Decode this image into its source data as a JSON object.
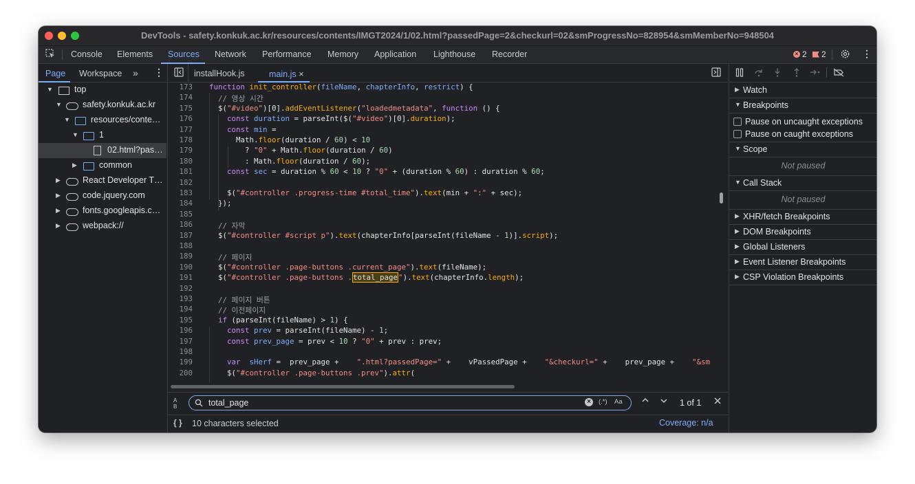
{
  "window": {
    "title": "DevTools - safety.konkuk.ac.kr/resources/contents/IMGT2024/1/02.html?passedPage=2&checkurl=02&smProgressNo=828954&smMemberNo=948504"
  },
  "main_tabs": [
    "Console",
    "Elements",
    "Sources",
    "Network",
    "Performance",
    "Memory",
    "Application",
    "Lighthouse",
    "Recorder"
  ],
  "active_main_tab": "Sources",
  "counts": {
    "errors": "2",
    "warnings": "2"
  },
  "navigator": {
    "tabs": [
      "Page",
      "Workspace"
    ],
    "more": "»",
    "tree": [
      {
        "label": "top",
        "type": "frame",
        "depth": 0,
        "arrow": "▼"
      },
      {
        "label": "safety.konkuk.ac.kr",
        "type": "cloud",
        "depth": 1,
        "arrow": "▼"
      },
      {
        "label": "resources/conte…",
        "type": "folder",
        "depth": 2,
        "arrow": "▼"
      },
      {
        "label": "1",
        "type": "folder",
        "depth": 3,
        "arrow": "▼"
      },
      {
        "label": "02.html?pas…",
        "type": "file",
        "depth": 4,
        "arrow": "",
        "selected": true
      },
      {
        "label": "common",
        "type": "folder",
        "depth": 3,
        "arrow": "▶"
      },
      {
        "label": "React Developer T…",
        "type": "cloud",
        "depth": 1,
        "arrow": "▶"
      },
      {
        "label": "code.jquery.com",
        "type": "cloud",
        "depth": 1,
        "arrow": "▶"
      },
      {
        "label": "fonts.googleapis.c…",
        "type": "cloud",
        "depth": 1,
        "arrow": "▶"
      },
      {
        "label": "webpack://",
        "type": "cloud",
        "depth": 1,
        "arrow": "▶"
      }
    ]
  },
  "editor": {
    "tabs": [
      {
        "label": "installHook.js",
        "active": false
      },
      {
        "label": "main.js",
        "active": true
      }
    ],
    "close": "×",
    "lines": [
      {
        "n": "173",
        "t": [
          [
            "kw",
            "function "
          ],
          [
            "fn",
            "init_controller"
          ],
          [
            "",
            "("
          ],
          [
            "vr",
            "fileName"
          ],
          [
            "",
            ", "
          ],
          [
            "vr",
            "chapterInfo"
          ],
          [
            "",
            ", "
          ],
          [
            "vr",
            "restrict"
          ],
          [
            "",
            ") {"
          ]
        ]
      },
      {
        "n": "174",
        "t": [
          [
            "",
            "  "
          ],
          [
            "cm",
            "// 영상 시간"
          ]
        ]
      },
      {
        "n": "175",
        "t": [
          [
            "",
            "  $("
          ],
          [
            "st",
            "\"#video\""
          ],
          [
            "",
            ")[0]."
          ],
          [
            "fn",
            "addEventListener"
          ],
          [
            "",
            "("
          ],
          [
            "st",
            "\"loadedmetadata\""
          ],
          [
            "",
            ", "
          ],
          [
            "kw",
            "function"
          ],
          [
            "",
            " () {"
          ]
        ]
      },
      {
        "n": "176",
        "t": [
          [
            "",
            "    "
          ],
          [
            "kw",
            "const "
          ],
          [
            "vr",
            "duration"
          ],
          [
            "",
            " = parseInt($("
          ],
          [
            "st",
            "\"#video\""
          ],
          [
            "",
            ")[0]."
          ],
          [
            "fn",
            "duration"
          ],
          [
            "",
            ");"
          ]
        ]
      },
      {
        "n": "177",
        "t": [
          [
            "",
            "    "
          ],
          [
            "kw",
            "const "
          ],
          [
            "vr",
            "min"
          ],
          [
            "",
            " ="
          ]
        ]
      },
      {
        "n": "178",
        "t": [
          [
            "",
            "      Math."
          ],
          [
            "fn",
            "floor"
          ],
          [
            "",
            "(duration / "
          ],
          [
            "num",
            "60"
          ],
          [
            "",
            ") < "
          ],
          [
            "num",
            "10"
          ]
        ]
      },
      {
        "n": "179",
        "t": [
          [
            "",
            "        ? "
          ],
          [
            "st",
            "\"0\""
          ],
          [
            "",
            " + Math."
          ],
          [
            "fn",
            "floor"
          ],
          [
            "",
            "(duration / "
          ],
          [
            "num",
            "60"
          ],
          [
            "",
            ")"
          ]
        ]
      },
      {
        "n": "180",
        "t": [
          [
            "",
            "        : Math."
          ],
          [
            "fn",
            "floor"
          ],
          [
            "",
            "(duration / "
          ],
          [
            "num",
            "60"
          ],
          [
            "",
            ");"
          ]
        ]
      },
      {
        "n": "181",
        "t": [
          [
            "",
            "    "
          ],
          [
            "kw",
            "const "
          ],
          [
            "vr",
            "sec"
          ],
          [
            "",
            " = duration % "
          ],
          [
            "num",
            "60"
          ],
          [
            "",
            " < "
          ],
          [
            "num",
            "10"
          ],
          [
            "",
            " ? "
          ],
          [
            "st",
            "\"0\""
          ],
          [
            "",
            " + (duration % "
          ],
          [
            "num",
            "60"
          ],
          [
            "",
            ") : duration % "
          ],
          [
            "num",
            "60"
          ],
          [
            "",
            ";"
          ]
        ]
      },
      {
        "n": "182",
        "t": []
      },
      {
        "n": "183",
        "t": [
          [
            "",
            "    $("
          ],
          [
            "st",
            "\"#controller .progress-time #total_time\""
          ],
          [
            "",
            ")."
          ],
          [
            "fn",
            "text"
          ],
          [
            "",
            "(min + "
          ],
          [
            "st",
            "\":\""
          ],
          [
            "",
            " + sec);"
          ]
        ]
      },
      {
        "n": "184",
        "t": [
          [
            "",
            "  });"
          ]
        ]
      },
      {
        "n": "185",
        "t": []
      },
      {
        "n": "186",
        "t": [
          [
            "",
            "  "
          ],
          [
            "cm",
            "// 자막"
          ]
        ]
      },
      {
        "n": "187",
        "t": [
          [
            "",
            "  $("
          ],
          [
            "st",
            "\"#controller #script p\""
          ],
          [
            "",
            ")."
          ],
          [
            "fn",
            "text"
          ],
          [
            "",
            "(chapterInfo[parseInt(fileName - "
          ],
          [
            "num",
            "1"
          ],
          [
            "",
            ")]."
          ],
          [
            "fn",
            "script"
          ],
          [
            "",
            ");"
          ]
        ]
      },
      {
        "n": "188",
        "t": []
      },
      {
        "n": "189",
        "t": [
          [
            "",
            "  "
          ],
          [
            "cm",
            "// 페이지"
          ]
        ]
      },
      {
        "n": "190",
        "t": [
          [
            "",
            "  $("
          ],
          [
            "st",
            "\"#controller .page-buttons .current_page\""
          ],
          [
            "",
            ")."
          ],
          [
            "fn",
            "text"
          ],
          [
            "",
            "(fileName);"
          ]
        ]
      },
      {
        "n": "191",
        "t": [
          [
            "",
            "  $("
          ],
          [
            "st",
            "\"#controller .page-buttons ."
          ],
          [
            "hl",
            "total_page"
          ],
          [
            "st",
            "\""
          ],
          [
            "",
            ")."
          ],
          [
            "fn",
            "text"
          ],
          [
            "",
            "(chapterInfo."
          ],
          [
            "fn",
            "length"
          ],
          [
            "",
            ");"
          ]
        ]
      },
      {
        "n": "192",
        "t": []
      },
      {
        "n": "193",
        "t": [
          [
            "",
            "  "
          ],
          [
            "cm",
            "// 페이지 버튼"
          ]
        ]
      },
      {
        "n": "194",
        "t": [
          [
            "",
            "  "
          ],
          [
            "cm",
            "// 이전페이지"
          ]
        ]
      },
      {
        "n": "195",
        "t": [
          [
            "",
            "  "
          ],
          [
            "kw",
            "if"
          ],
          [
            "",
            " (parseInt(fileName) > "
          ],
          [
            "num",
            "1"
          ],
          [
            "",
            ") {"
          ]
        ]
      },
      {
        "n": "196",
        "t": [
          [
            "",
            "    "
          ],
          [
            "kw",
            "const "
          ],
          [
            "vr",
            "prev"
          ],
          [
            "",
            " = parseInt(fileName) - "
          ],
          [
            "num",
            "1"
          ],
          [
            "",
            ";"
          ]
        ]
      },
      {
        "n": "197",
        "t": [
          [
            "",
            "    "
          ],
          [
            "kw",
            "const "
          ],
          [
            "vr",
            "prev_page"
          ],
          [
            "",
            " = prev < "
          ],
          [
            "num",
            "10"
          ],
          [
            "",
            " ? "
          ],
          [
            "st",
            "\"0\""
          ],
          [
            "",
            " + prev : prev;"
          ]
        ]
      },
      {
        "n": "198",
        "t": []
      },
      {
        "n": "199",
        "t": [
          [
            "",
            "    "
          ],
          [
            "kw",
            "var  "
          ],
          [
            "vr",
            "sHerf"
          ],
          [
            "",
            " =  prev_page +    "
          ],
          [
            "st",
            "\".html?passedPage=\""
          ],
          [
            "",
            " +    vPassedPage +    "
          ],
          [
            "st",
            "\"&checkurl=\""
          ],
          [
            "",
            " +    prev_page +    "
          ],
          [
            "st",
            "\"&sm"
          ]
        ]
      },
      {
        "n": "200",
        "t": [
          [
            "",
            "    $("
          ],
          [
            "st",
            "\"#controller .page-buttons .prev\""
          ],
          [
            "",
            ")."
          ],
          [
            "fn",
            "attr"
          ],
          [
            "",
            "("
          ]
        ]
      }
    ]
  },
  "search": {
    "value": "total_page",
    "match_count": "1 of 1",
    "regex_label": "(.*)",
    "case_label": "Aa",
    "left_icon": "A B"
  },
  "status": {
    "selection": "10 characters selected",
    "coverage": "Coverage: n/a",
    "braces": "{ }"
  },
  "debugger": {
    "sections": {
      "watch": "Watch",
      "breakpoints": "Breakpoints",
      "pause_uncaught": "Pause on uncaught exceptions",
      "pause_caught": "Pause on caught exceptions",
      "scope": "Scope",
      "scope_status": "Not paused",
      "call_stack": "Call Stack",
      "call_stack_status": "Not paused",
      "xhr": "XHR/fetch Breakpoints",
      "dom": "DOM Breakpoints",
      "global": "Global Listeners",
      "event": "Event Listener Breakpoints",
      "csp": "CSP Violation Breakpoints"
    }
  }
}
